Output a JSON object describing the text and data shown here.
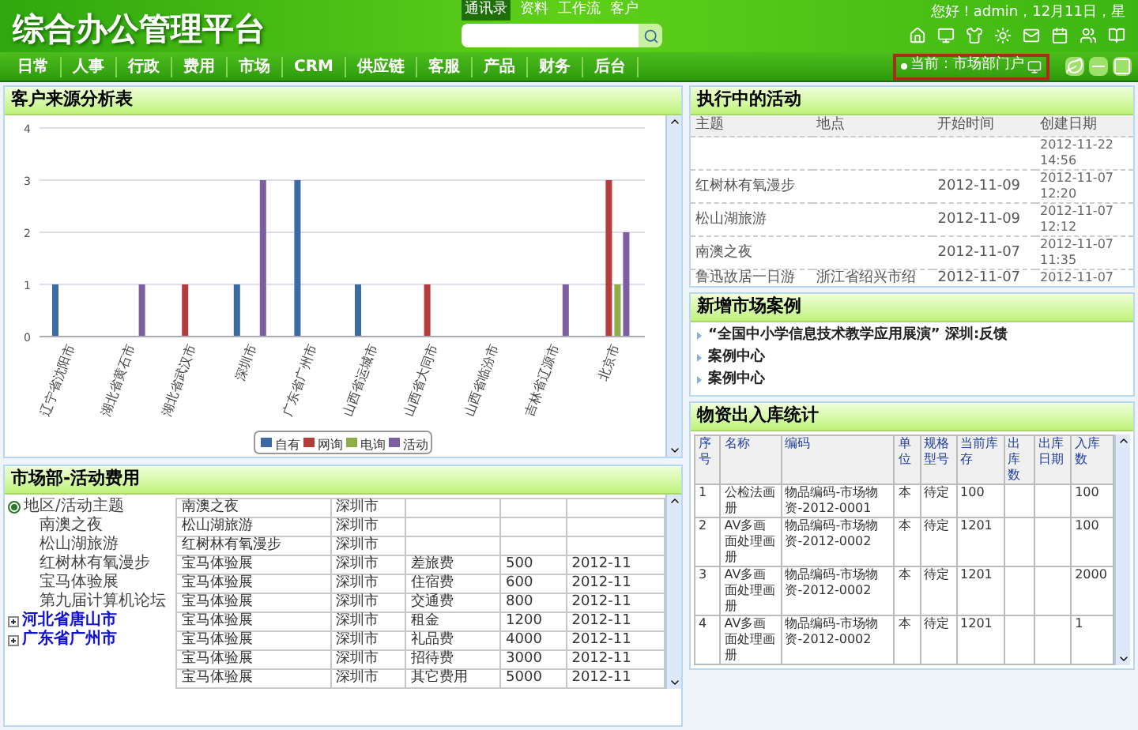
{
  "header": {
    "title": "综合办公管理平台",
    "greeting": "您好！admin，12月11日，星",
    "search_tabs": [
      {
        "label": "通讯录",
        "selected": true
      },
      {
        "label": "资料",
        "selected": false
      },
      {
        "label": "工作流",
        "selected": false
      },
      {
        "label": "客户",
        "selected": false
      }
    ]
  },
  "nav": {
    "items": [
      "日常",
      "人事",
      "行政",
      "费用",
      "市场",
      "CRM",
      "供应链",
      "客服",
      "产品",
      "财务",
      "后台"
    ],
    "current": "当前：市场部门户"
  },
  "customer_source": {
    "title": "客户来源分析表",
    "chart_data": {
      "type": "bar",
      "categories": [
        "辽宁省沈阳市",
        "湖北省黄石市",
        "湖北省武汉市",
        "深圳市",
        "广东省广州市",
        "山西省运城市",
        "山西省大同市",
        "山西省临汾市",
        "吉林省辽源市",
        "北京市"
      ],
      "series": [
        {
          "name": "自有",
          "color": "#3d6aa3",
          "values": [
            1,
            0,
            0,
            1,
            3,
            1,
            0,
            0,
            0,
            0
          ]
        },
        {
          "name": "网询",
          "color": "#b33c3c",
          "values": [
            0,
            0,
            1,
            0,
            0,
            0,
            1,
            0,
            0,
            3
          ]
        },
        {
          "name": "电询",
          "color": "#8cad48",
          "values": [
            0,
            0,
            0,
            0,
            0,
            0,
            0,
            0,
            0,
            1
          ]
        },
        {
          "name": "活动",
          "color": "#7d5e9e",
          "values": [
            0,
            1,
            0,
            3,
            0,
            0,
            0,
            0,
            1,
            2
          ]
        }
      ],
      "ylim": [
        0,
        4
      ],
      "yticks": [
        0,
        1,
        2,
        3,
        4
      ],
      "grid": true,
      "legend": true
    }
  },
  "expenses": {
    "title": "市场部-活动费用",
    "tree": [
      {
        "label": "地区/活动主题",
        "expanded": true,
        "children": [
          {
            "label": "南澳之夜"
          },
          {
            "label": "松山湖旅游"
          },
          {
            "label": "红树林有氧漫步"
          },
          {
            "label": "宝马体验展"
          },
          {
            "label": "第九届计算机论坛"
          }
        ]
      },
      {
        "label": "河北省唐山市",
        "expanded": false
      },
      {
        "label": "广东省广州市",
        "expanded": false
      }
    ],
    "rows": [
      [
        "南澳之夜",
        "深圳市",
        "",
        "",
        ""
      ],
      [
        "松山湖旅游",
        "深圳市",
        "",
        "",
        ""
      ],
      [
        "红树林有氧漫步",
        "深圳市",
        "",
        "",
        ""
      ],
      [
        "宝马体验展",
        "深圳市",
        "差旅费",
        "500",
        "2012-11"
      ],
      [
        "宝马体验展",
        "深圳市",
        "住宿费",
        "600",
        "2012-11"
      ],
      [
        "宝马体验展",
        "深圳市",
        "交通费",
        "800",
        "2012-11"
      ],
      [
        "宝马体验展",
        "深圳市",
        "租金",
        "1200",
        "2012-11"
      ],
      [
        "宝马体验展",
        "深圳市",
        "礼品费",
        "4000",
        "2012-11"
      ],
      [
        "宝马体验展",
        "深圳市",
        "招待费",
        "3000",
        "2012-11"
      ],
      [
        "宝马体验展",
        "深圳市",
        "其它费用",
        "5000",
        "2012-11"
      ]
    ]
  },
  "activities": {
    "title": "执行中的活动",
    "columns": [
      "主题",
      "地点",
      "开始时间",
      "创建日期"
    ],
    "rows": [
      [
        "",
        "",
        "",
        "2012-11-22 14:56"
      ],
      [
        "红树林有氧漫步",
        "",
        "2012-11-09",
        "2012-11-07 12:20"
      ],
      [
        "松山湖旅游",
        "",
        "2012-11-09",
        "2012-11-07 12:12"
      ],
      [
        "南澳之夜",
        "",
        "2012-11-07",
        "2012-11-07 11:35"
      ],
      [
        "鲁迅故居一日游",
        "浙江省绍兴市绍",
        "2012-11-07",
        "2012-11-07"
      ]
    ]
  },
  "cases": {
    "title": "新增市场案例",
    "items": [
      "“全国中小学信息技术教学应用展演” 深圳:反馈",
      "案例中心",
      "案例中心"
    ]
  },
  "inventory": {
    "title": "物资出入库统计",
    "columns": [
      "序号",
      "名称",
      "编码",
      "单位",
      "规格型号",
      "当前库存",
      "出库数",
      "出库日期",
      "入库数"
    ],
    "rows": [
      [
        "1",
        "公检法画册",
        "物品编码-市场物资-2012-0001",
        "本",
        "待定",
        "100",
        "",
        "",
        "100"
      ],
      [
        "2",
        "AV多画面处理画册",
        "物品编码-市场物资-2012-0002",
        "本",
        "待定",
        "1201",
        "",
        "",
        "100"
      ],
      [
        "3",
        "AV多画面处理画册",
        "物品编码-市场物资-2012-0002",
        "本",
        "待定",
        "1201",
        "",
        "",
        "2000"
      ],
      [
        "4",
        "AV多画面处理画册",
        "物品编码-市场物资-2012-0002",
        "本",
        "待定",
        "1201",
        "",
        "",
        "1"
      ]
    ]
  }
}
